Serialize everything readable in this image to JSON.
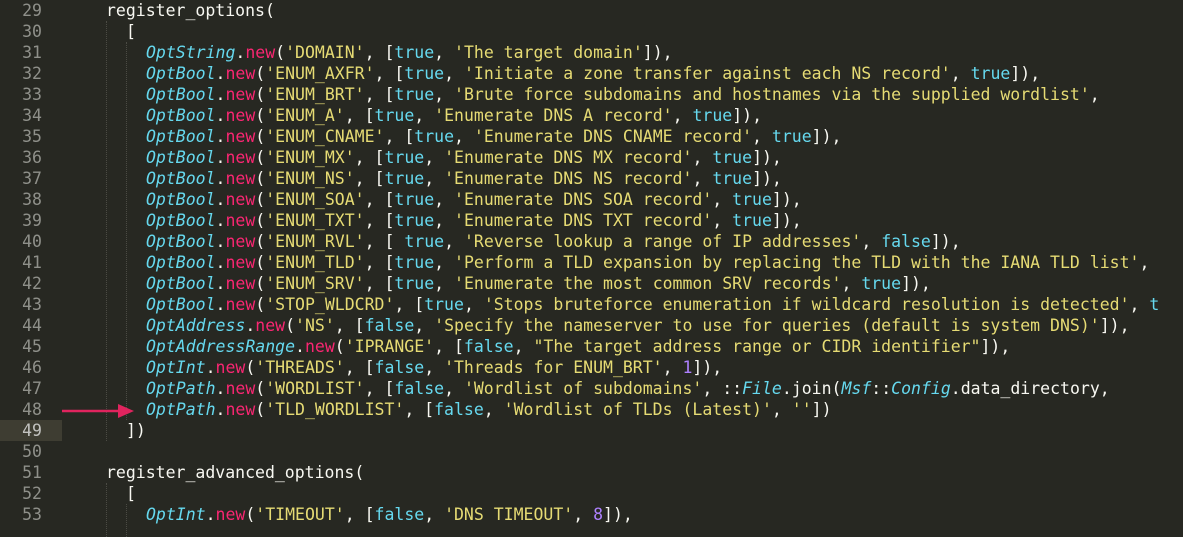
{
  "editor": {
    "cursor_line": "49",
    "accent_colors": {
      "background": "#272822",
      "class": "#66d9ef",
      "keyword": "#f92672",
      "string": "#e6db74",
      "number": "#ae81ff",
      "arrow": "#e0245e"
    },
    "annotation_icon": "arrow-right-icon",
    "lines": [
      {
        "n": "29",
        "indent": 1,
        "tokens": [
          [
            "def",
            "register_options("
          ]
        ]
      },
      {
        "n": "30",
        "indent": 2,
        "tokens": [
          [
            "def",
            "["
          ]
        ]
      },
      {
        "n": "31",
        "indent": 3,
        "tokens": [
          [
            "class",
            "OptString"
          ],
          [
            "def",
            "."
          ],
          [
            "kw",
            "new"
          ],
          [
            "def",
            "("
          ],
          [
            "str",
            "'DOMAIN'"
          ],
          [
            "def",
            ", ["
          ],
          [
            "const",
            "true"
          ],
          [
            "def",
            ", "
          ],
          [
            "str",
            "'The target domain'"
          ],
          [
            "def",
            "]),"
          ]
        ]
      },
      {
        "n": "32",
        "indent": 3,
        "tokens": [
          [
            "class",
            "OptBool"
          ],
          [
            "def",
            "."
          ],
          [
            "kw",
            "new"
          ],
          [
            "def",
            "("
          ],
          [
            "str",
            "'ENUM_AXFR'"
          ],
          [
            "def",
            ", ["
          ],
          [
            "const",
            "true"
          ],
          [
            "def",
            ", "
          ],
          [
            "str",
            "'Initiate a zone transfer against each NS record'"
          ],
          [
            "def",
            ", "
          ],
          [
            "const",
            "true"
          ],
          [
            "def",
            "]),"
          ]
        ]
      },
      {
        "n": "33",
        "indent": 3,
        "tokens": [
          [
            "class",
            "OptBool"
          ],
          [
            "def",
            "."
          ],
          [
            "kw",
            "new"
          ],
          [
            "def",
            "("
          ],
          [
            "str",
            "'ENUM_BRT'"
          ],
          [
            "def",
            ", ["
          ],
          [
            "const",
            "true"
          ],
          [
            "def",
            ", "
          ],
          [
            "str",
            "'Brute force subdomains and hostnames via the supplied wordlist'"
          ],
          [
            "def",
            ","
          ]
        ]
      },
      {
        "n": "34",
        "indent": 3,
        "tokens": [
          [
            "class",
            "OptBool"
          ],
          [
            "def",
            "."
          ],
          [
            "kw",
            "new"
          ],
          [
            "def",
            "("
          ],
          [
            "str",
            "'ENUM_A'"
          ],
          [
            "def",
            ", ["
          ],
          [
            "const",
            "true"
          ],
          [
            "def",
            ", "
          ],
          [
            "str",
            "'Enumerate DNS A record'"
          ],
          [
            "def",
            ", "
          ],
          [
            "const",
            "true"
          ],
          [
            "def",
            "]),"
          ]
        ]
      },
      {
        "n": "35",
        "indent": 3,
        "tokens": [
          [
            "class",
            "OptBool"
          ],
          [
            "def",
            "."
          ],
          [
            "kw",
            "new"
          ],
          [
            "def",
            "("
          ],
          [
            "str",
            "'ENUM_CNAME'"
          ],
          [
            "def",
            ", ["
          ],
          [
            "const",
            "true"
          ],
          [
            "def",
            ", "
          ],
          [
            "str",
            "'Enumerate DNS CNAME record'"
          ],
          [
            "def",
            ", "
          ],
          [
            "const",
            "true"
          ],
          [
            "def",
            "]),"
          ]
        ]
      },
      {
        "n": "36",
        "indent": 3,
        "tokens": [
          [
            "class",
            "OptBool"
          ],
          [
            "def",
            "."
          ],
          [
            "kw",
            "new"
          ],
          [
            "def",
            "("
          ],
          [
            "str",
            "'ENUM_MX'"
          ],
          [
            "def",
            ", ["
          ],
          [
            "const",
            "true"
          ],
          [
            "def",
            ", "
          ],
          [
            "str",
            "'Enumerate DNS MX record'"
          ],
          [
            "def",
            ", "
          ],
          [
            "const",
            "true"
          ],
          [
            "def",
            "]),"
          ]
        ]
      },
      {
        "n": "37",
        "indent": 3,
        "tokens": [
          [
            "class",
            "OptBool"
          ],
          [
            "def",
            "."
          ],
          [
            "kw",
            "new"
          ],
          [
            "def",
            "("
          ],
          [
            "str",
            "'ENUM_NS'"
          ],
          [
            "def",
            ", ["
          ],
          [
            "const",
            "true"
          ],
          [
            "def",
            ", "
          ],
          [
            "str",
            "'Enumerate DNS NS record'"
          ],
          [
            "def",
            ", "
          ],
          [
            "const",
            "true"
          ],
          [
            "def",
            "]),"
          ]
        ]
      },
      {
        "n": "38",
        "indent": 3,
        "tokens": [
          [
            "class",
            "OptBool"
          ],
          [
            "def",
            "."
          ],
          [
            "kw",
            "new"
          ],
          [
            "def",
            "("
          ],
          [
            "str",
            "'ENUM_SOA'"
          ],
          [
            "def",
            ", ["
          ],
          [
            "const",
            "true"
          ],
          [
            "def",
            ", "
          ],
          [
            "str",
            "'Enumerate DNS SOA record'"
          ],
          [
            "def",
            ", "
          ],
          [
            "const",
            "true"
          ],
          [
            "def",
            "]),"
          ]
        ]
      },
      {
        "n": "39",
        "indent": 3,
        "tokens": [
          [
            "class",
            "OptBool"
          ],
          [
            "def",
            "."
          ],
          [
            "kw",
            "new"
          ],
          [
            "def",
            "("
          ],
          [
            "str",
            "'ENUM_TXT'"
          ],
          [
            "def",
            ", ["
          ],
          [
            "const",
            "true"
          ],
          [
            "def",
            ", "
          ],
          [
            "str",
            "'Enumerate DNS TXT record'"
          ],
          [
            "def",
            ", "
          ],
          [
            "const",
            "true"
          ],
          [
            "def",
            "]),"
          ]
        ]
      },
      {
        "n": "40",
        "indent": 3,
        "tokens": [
          [
            "class",
            "OptBool"
          ],
          [
            "def",
            "."
          ],
          [
            "kw",
            "new"
          ],
          [
            "def",
            "("
          ],
          [
            "str",
            "'ENUM_RVL'"
          ],
          [
            "def",
            ", [ "
          ],
          [
            "const",
            "true"
          ],
          [
            "def",
            ", "
          ],
          [
            "str",
            "'Reverse lookup a range of IP addresses'"
          ],
          [
            "def",
            ", "
          ],
          [
            "const",
            "false"
          ],
          [
            "def",
            "]),"
          ]
        ]
      },
      {
        "n": "41",
        "indent": 3,
        "tokens": [
          [
            "class",
            "OptBool"
          ],
          [
            "def",
            "."
          ],
          [
            "kw",
            "new"
          ],
          [
            "def",
            "("
          ],
          [
            "str",
            "'ENUM_TLD'"
          ],
          [
            "def",
            ", ["
          ],
          [
            "const",
            "true"
          ],
          [
            "def",
            ", "
          ],
          [
            "str",
            "'Perform a TLD expansion by replacing the TLD with the IANA TLD list'"
          ],
          [
            "def",
            ","
          ]
        ]
      },
      {
        "n": "42",
        "indent": 3,
        "tokens": [
          [
            "class",
            "OptBool"
          ],
          [
            "def",
            "."
          ],
          [
            "kw",
            "new"
          ],
          [
            "def",
            "("
          ],
          [
            "str",
            "'ENUM_SRV'"
          ],
          [
            "def",
            ", ["
          ],
          [
            "const",
            "true"
          ],
          [
            "def",
            ", "
          ],
          [
            "str",
            "'Enumerate the most common SRV records'"
          ],
          [
            "def",
            ", "
          ],
          [
            "const",
            "true"
          ],
          [
            "def",
            "]),"
          ]
        ]
      },
      {
        "n": "43",
        "indent": 3,
        "tokens": [
          [
            "class",
            "OptBool"
          ],
          [
            "def",
            "."
          ],
          [
            "kw",
            "new"
          ],
          [
            "def",
            "("
          ],
          [
            "str",
            "'STOP_WLDCRD'"
          ],
          [
            "def",
            ", ["
          ],
          [
            "const",
            "true"
          ],
          [
            "def",
            ", "
          ],
          [
            "str",
            "'Stops bruteforce enumeration if wildcard resolution is detected'"
          ],
          [
            "def",
            ", "
          ],
          [
            "const",
            "t"
          ]
        ]
      },
      {
        "n": "44",
        "indent": 3,
        "tokens": [
          [
            "class",
            "OptAddress"
          ],
          [
            "def",
            "."
          ],
          [
            "kw",
            "new"
          ],
          [
            "def",
            "("
          ],
          [
            "str",
            "'NS'"
          ],
          [
            "def",
            ", ["
          ],
          [
            "const",
            "false"
          ],
          [
            "def",
            ", "
          ],
          [
            "str",
            "'Specify the nameserver to use for queries (default is system DNS)'"
          ],
          [
            "def",
            "]),"
          ]
        ]
      },
      {
        "n": "45",
        "indent": 3,
        "tokens": [
          [
            "class",
            "OptAddressRange"
          ],
          [
            "def",
            "."
          ],
          [
            "kw",
            "new"
          ],
          [
            "def",
            "("
          ],
          [
            "str",
            "'IPRANGE'"
          ],
          [
            "def",
            ", ["
          ],
          [
            "const",
            "false"
          ],
          [
            "def",
            ", "
          ],
          [
            "str",
            "\"The target address range or CIDR identifier\""
          ],
          [
            "def",
            "]),"
          ]
        ]
      },
      {
        "n": "46",
        "indent": 3,
        "tokens": [
          [
            "class",
            "OptInt"
          ],
          [
            "def",
            "."
          ],
          [
            "kw",
            "new"
          ],
          [
            "def",
            "("
          ],
          [
            "str",
            "'THREADS'"
          ],
          [
            "def",
            ", ["
          ],
          [
            "const",
            "false"
          ],
          [
            "def",
            ", "
          ],
          [
            "str",
            "'Threads for ENUM_BRT'"
          ],
          [
            "def",
            ", "
          ],
          [
            "num",
            "1"
          ],
          [
            "def",
            "]),"
          ]
        ]
      },
      {
        "n": "47",
        "indent": 3,
        "tokens": [
          [
            "class",
            "OptPath"
          ],
          [
            "def",
            "."
          ],
          [
            "kw",
            "new"
          ],
          [
            "def",
            "("
          ],
          [
            "str",
            "'WORDLIST'"
          ],
          [
            "def",
            ", ["
          ],
          [
            "const",
            "false"
          ],
          [
            "def",
            ", "
          ],
          [
            "str",
            "'Wordlist of subdomains'"
          ],
          [
            "def",
            ", ::"
          ],
          [
            "class",
            "File"
          ],
          [
            "def",
            ".join("
          ],
          [
            "class",
            "Msf"
          ],
          [
            "def",
            "::"
          ],
          [
            "class",
            "Config"
          ],
          [
            "def",
            ".data_directory,"
          ]
        ]
      },
      {
        "n": "48",
        "indent": 3,
        "tokens": [
          [
            "class",
            "OptPath"
          ],
          [
            "def",
            "."
          ],
          [
            "kw",
            "new"
          ],
          [
            "def",
            "("
          ],
          [
            "str",
            "'TLD_WORDLIST'"
          ],
          [
            "def",
            ", ["
          ],
          [
            "const",
            "false"
          ],
          [
            "def",
            ", "
          ],
          [
            "str",
            "'Wordlist of TLDs (Latest)'"
          ],
          [
            "def",
            ", "
          ],
          [
            "str",
            "''"
          ],
          [
            "def",
            "])"
          ]
        ]
      },
      {
        "n": "49",
        "indent": 2,
        "tokens": [
          [
            "def",
            "])"
          ]
        ]
      },
      {
        "n": "50",
        "indent": 0,
        "tokens": []
      },
      {
        "n": "51",
        "indent": 1,
        "tokens": [
          [
            "def",
            "register_advanced_options("
          ]
        ]
      },
      {
        "n": "52",
        "indent": 2,
        "tokens": [
          [
            "def",
            "["
          ]
        ]
      },
      {
        "n": "53",
        "indent": 3,
        "tokens": [
          [
            "class",
            "OptInt"
          ],
          [
            "def",
            "."
          ],
          [
            "kw",
            "new"
          ],
          [
            "def",
            "("
          ],
          [
            "str",
            "'TIMEOUT'"
          ],
          [
            "def",
            ", ["
          ],
          [
            "const",
            "false"
          ],
          [
            "def",
            ", "
          ],
          [
            "str",
            "'DNS TIMEOUT'"
          ],
          [
            "def",
            ", "
          ],
          [
            "num",
            "8"
          ],
          [
            "def",
            "]),"
          ]
        ]
      }
    ]
  }
}
